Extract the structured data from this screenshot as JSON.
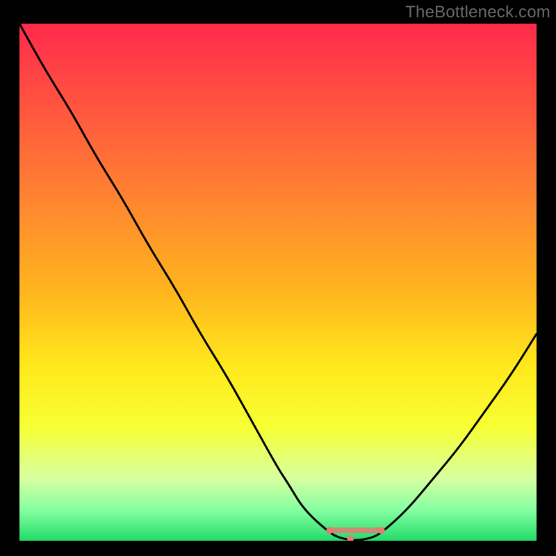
{
  "watermark": "TheBottleneck.com",
  "chart_data": {
    "type": "line",
    "title": "",
    "xlabel": "",
    "ylabel": "",
    "x": [
      0,
      5,
      10,
      15,
      20,
      25,
      30,
      35,
      40,
      45,
      50,
      52,
      55,
      60,
      62,
      65,
      68,
      70,
      75,
      80,
      85,
      90,
      95,
      100
    ],
    "values": [
      100,
      91,
      83,
      74,
      66,
      57,
      49,
      40,
      32,
      23,
      14,
      11,
      6,
      1.5,
      0.5,
      0,
      0.5,
      1.5,
      6,
      12,
      18,
      25,
      32,
      40
    ],
    "markers": [
      {
        "x": 60,
        "y": 2.0
      },
      {
        "x": 64,
        "y": 0.4
      },
      {
        "x": 70,
        "y": 2.0
      }
    ],
    "ylim": [
      0,
      100
    ],
    "xlim": [
      0,
      100
    ],
    "curve_color": "#000000",
    "curve_width": 3,
    "marker_color": "#e77a73",
    "marker_radius": 5,
    "gradient_stops": [
      {
        "offset": 0.0,
        "color": "#ff2a4b"
      },
      {
        "offset": 0.18,
        "color": "#ff5a3e"
      },
      {
        "offset": 0.36,
        "color": "#ff8a2f"
      },
      {
        "offset": 0.52,
        "color": "#ffb61e"
      },
      {
        "offset": 0.66,
        "color": "#ffe81c"
      },
      {
        "offset": 0.78,
        "color": "#f7ff33"
      },
      {
        "offset": 0.88,
        "color": "#d7ffa0"
      },
      {
        "offset": 0.94,
        "color": "#86ffa2"
      },
      {
        "offset": 1.0,
        "color": "#23db6a"
      }
    ]
  }
}
